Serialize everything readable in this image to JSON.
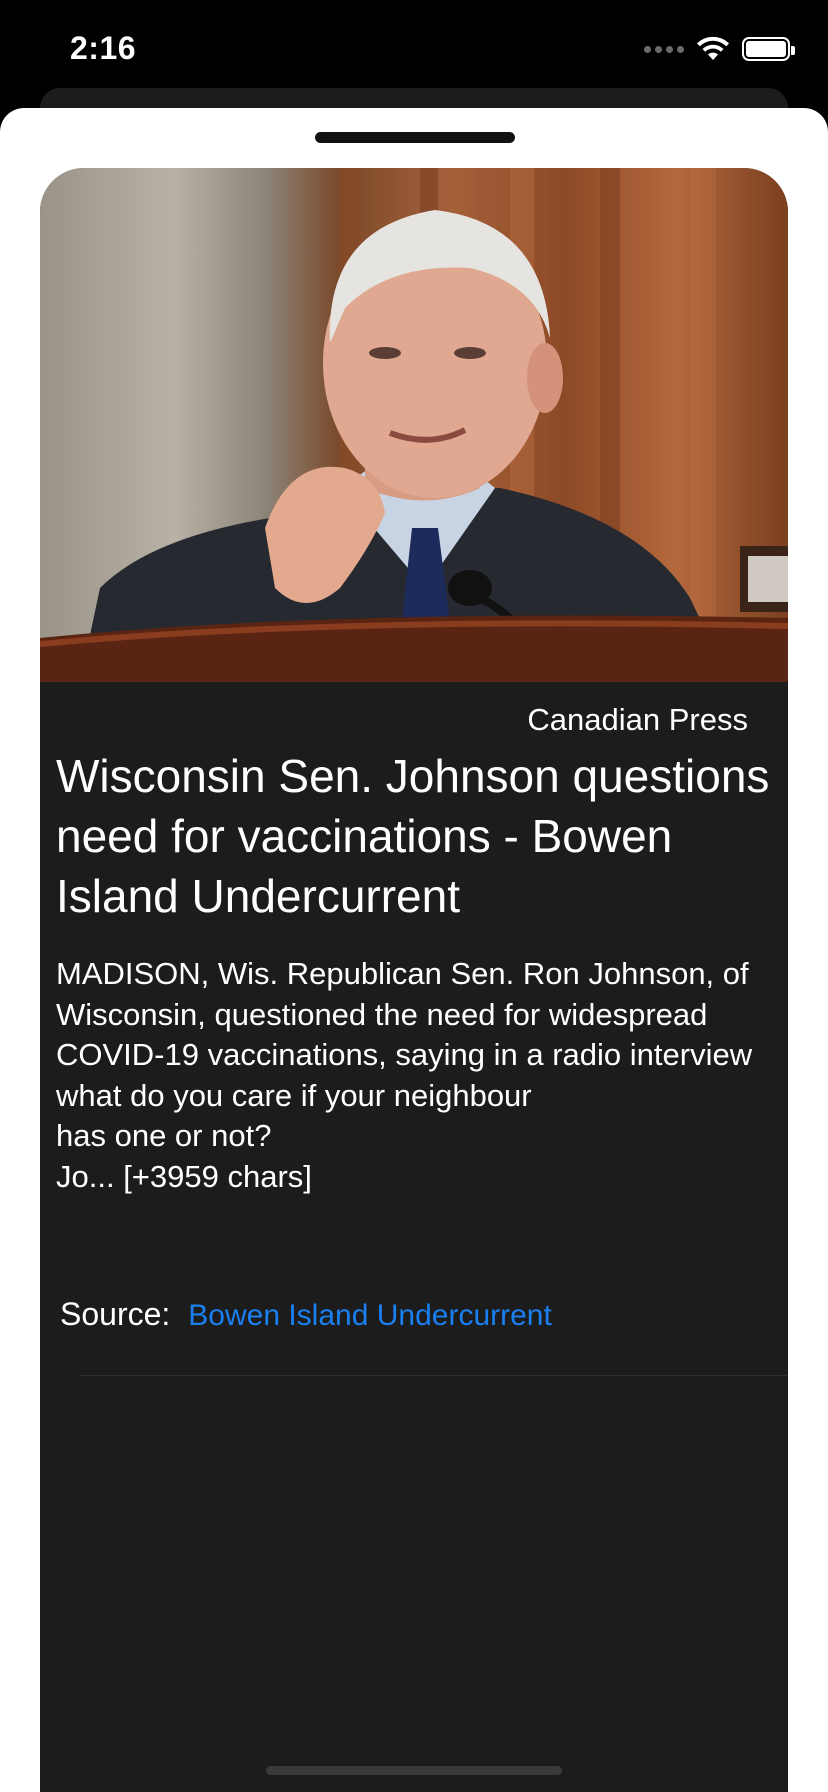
{
  "status_bar": {
    "time": "2:16",
    "icons": [
      "cellular-signal-icon",
      "wifi-icon",
      "battery-icon"
    ]
  },
  "article": {
    "image": "senator-photo",
    "publisher": "Canadian Press",
    "title": "Wisconsin Sen. Johnson questions need for vaccinations - Bowen Island Undercurrent",
    "description": "MADISON, Wis. Republican Sen. Ron Johnson, of Wisconsin, questioned the need for widespread COVID-19 vaccinations, saying in a radio interview what do you care if your neighbour\n has one or not?\nJo... [+3959 chars]",
    "source_label": "Source:",
    "source_link": "Bowen Island Undercurrent"
  },
  "colors": {
    "background": "#000000",
    "sheet": "#ffffff",
    "card": "#1c1c1c",
    "link": "#1a7ff0"
  }
}
